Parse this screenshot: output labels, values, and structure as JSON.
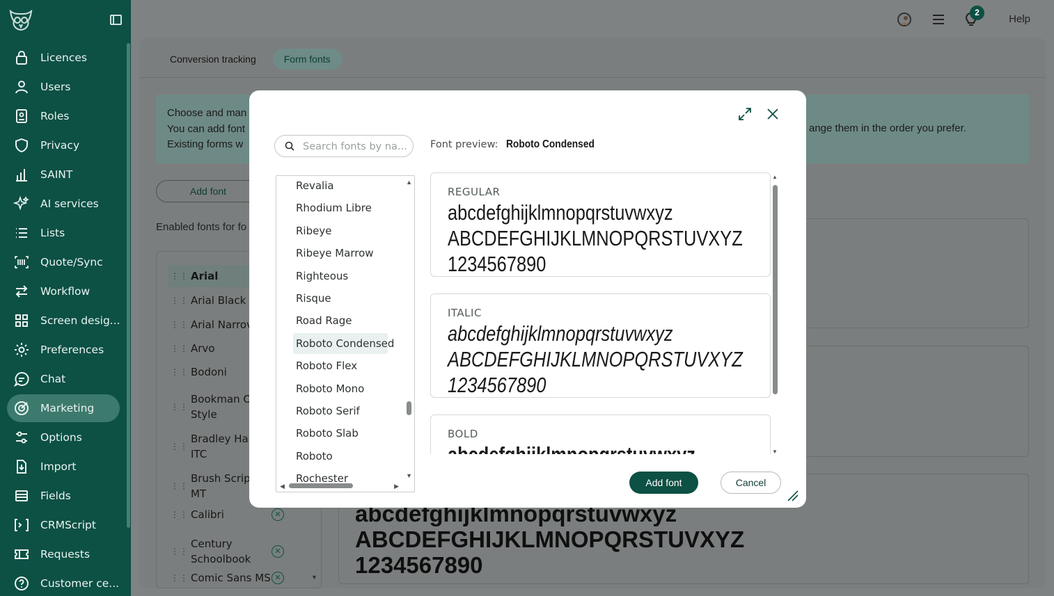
{
  "sidebar": {
    "items": [
      {
        "label": "Licences",
        "icon": "lock-icon"
      },
      {
        "label": "Users",
        "icon": "user-icon"
      },
      {
        "label": "Roles",
        "icon": "roles-icon"
      },
      {
        "label": "Privacy",
        "icon": "shield-icon"
      },
      {
        "label": "SAINT",
        "icon": "bar-chart-icon"
      },
      {
        "label": "AI services",
        "icon": "sparkle-icon"
      },
      {
        "label": "Lists",
        "icon": "list-icon"
      },
      {
        "label": "Quote/Sync",
        "icon": "barcode-icon"
      },
      {
        "label": "Workflow",
        "icon": "arrows-icon"
      },
      {
        "label": "Screen desig...",
        "icon": "grid-icon"
      },
      {
        "label": "Preferences",
        "icon": "gear-icon"
      },
      {
        "label": "Chat",
        "icon": "chat-icon"
      },
      {
        "label": "Marketing",
        "icon": "target-icon",
        "active": true
      },
      {
        "label": "Options",
        "icon": "sliders-icon"
      },
      {
        "label": "Import",
        "icon": "import-icon"
      },
      {
        "label": "Fields",
        "icon": "fields-icon"
      },
      {
        "label": "CRMScript",
        "icon": "script-icon"
      },
      {
        "label": "Requests",
        "icon": "ticket-icon"
      },
      {
        "label": "Customer ce...",
        "icon": "help-circle-icon"
      }
    ]
  },
  "topbar": {
    "help": "Help",
    "notifications_count": "2"
  },
  "main": {
    "tabs": [
      {
        "label": "Conversion tracking",
        "active": false
      },
      {
        "label": "Form fonts",
        "active": true
      }
    ],
    "info_lines": [
      "Choose and man",
      "You can add font",
      "Existing forms w"
    ],
    "info_right": "ange them in the order you prefer.",
    "add_font": "Add font",
    "enabled_label": "Enabled fonts for fo",
    "fonts": [
      {
        "name": "Arial",
        "selected": true
      },
      {
        "name": "Arial Black"
      },
      {
        "name": "Arial Narrov"
      },
      {
        "name": "Arvo"
      },
      {
        "name": "Bodoni"
      },
      {
        "name": "Bookman O",
        "name2": "Style"
      },
      {
        "name": "Bradley Har",
        "name2": "ITC"
      },
      {
        "name": "Brush Script",
        "name2": "MT"
      },
      {
        "name": "Calibri",
        "removable": true
      },
      {
        "name": "Century",
        "name2": "Schoolbook",
        "removable": true
      },
      {
        "name": "Comic Sans MS",
        "removable": true
      }
    ],
    "sample_lines": [
      "abcdefghijklmnopqrstuvwxyz",
      "ABCDEFGHIJKLMNOPQRSTUVXYZ",
      "1234567890"
    ]
  },
  "modal": {
    "search_placeholder": "Search fonts by na...",
    "preview_label": "Font preview:",
    "preview_font": "Roboto Condensed",
    "font_list": [
      "Revalia",
      "Rhodium Libre",
      "Ribeye",
      "Ribeye Marrow",
      "Righteous",
      "Risque",
      "Road Rage",
      "Roboto Condensed",
      "Roboto Flex",
      "Roboto Mono",
      "Roboto Serif",
      "Roboto Slab",
      "Roboto",
      "Rochester"
    ],
    "selected_font": "Roboto Condensed",
    "previews": [
      {
        "title": "REGULAR",
        "lines": [
          "abcdefghijklmnopqrstuvwxyz",
          "ABCDEFGHIJKLMNOPQRSTUVXYZ",
          "1234567890"
        ]
      },
      {
        "title": "ITALIC",
        "lines": [
          "abcdefghijklmnopqrstuvwxyz",
          "ABCDEFGHIJKLMNOPQRSTUVXYZ",
          "1234567890"
        ]
      },
      {
        "title": "BOLD",
        "lines": [
          "abcdefghijklmnopqrstuvwxyz"
        ]
      }
    ],
    "add_button": "Add font",
    "cancel_button": "Cancel"
  },
  "colors": {
    "sidebar_bg": "#0d5044",
    "accent": "#0d5044",
    "overlay": "#7f8282"
  }
}
